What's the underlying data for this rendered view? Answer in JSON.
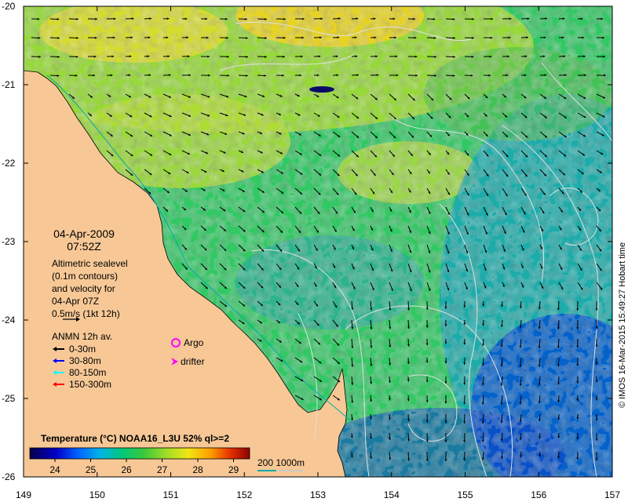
{
  "map": {
    "date": "04-Apr-2009",
    "time": "07:52Z",
    "altimetry_text": [
      "Altimetric sealevel",
      "(0.1m contours)",
      "and velocity for",
      "04-Apr 07Z",
      "0.5m/s (1kt 12h)"
    ],
    "anmn": {
      "title": "ANMN 12h av.",
      "items": [
        {
          "label": "0-30m",
          "color": "#000000"
        },
        {
          "label": "30-80m",
          "color": "#0000ff"
        },
        {
          "label": "80-150m",
          "color": "#00ffff"
        },
        {
          "label": "150-300m",
          "color": "#ff0000"
        }
      ]
    },
    "argo_label": "Argo",
    "drifter_label": "drifter",
    "colorbar": {
      "title": "Temperature (°C) NOAA16_L3U 52% ql>=2",
      "ticks": [
        "24",
        "25",
        "26",
        "27",
        "28",
        "29"
      ]
    },
    "bathy_label": "200  1000m",
    "credit": "© IMOS 16-Mar-2015 15:49:27 Hobart time",
    "lat_ticks": [
      "-20",
      "-21",
      "-22",
      "-23",
      "-24",
      "-25",
      "-26"
    ],
    "lon_ticks": [
      "149",
      "150",
      "151",
      "152",
      "153",
      "154",
      "155",
      "156",
      "157"
    ],
    "colors": {
      "land": "#f7c896",
      "argo": "#ff00ff",
      "drifter": "#ff00ff",
      "bathy_200": "#00aaaa",
      "bathy_1000": "#c8c8c8"
    }
  }
}
